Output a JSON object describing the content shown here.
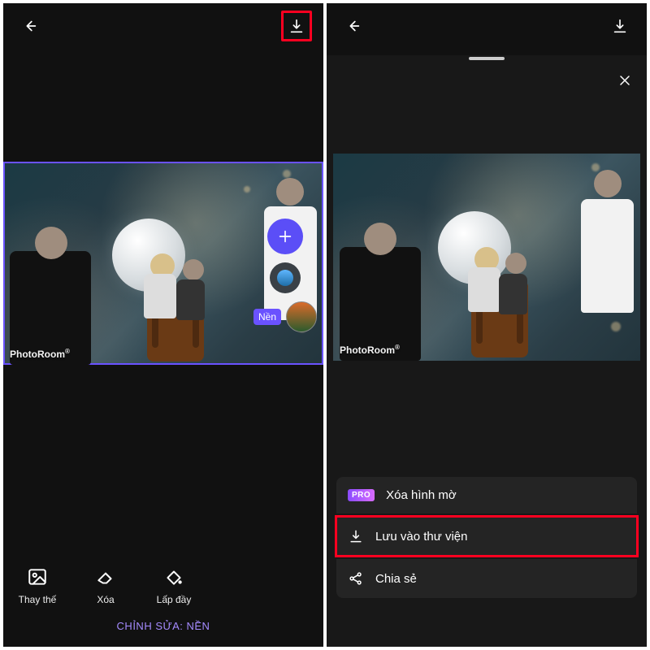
{
  "colors": {
    "accent": "#5b4ef7",
    "highlight": "#ff0020",
    "sectionLabel": "#a58bff"
  },
  "watermark": "PhotoRoom",
  "screen1": {
    "layerTag": "Nền",
    "tools": {
      "replace": "Thay thế",
      "erase": "Xóa",
      "fill": "Lấp đầy"
    },
    "sectionLabel": "CHỈNH SỬA: NỀN"
  },
  "screen2": {
    "proBadge": "PRO",
    "actions": {
      "removeWatermark": "Xóa hình mờ",
      "saveToLibrary": "Lưu vào thư viện",
      "share": "Chia sẻ"
    }
  }
}
